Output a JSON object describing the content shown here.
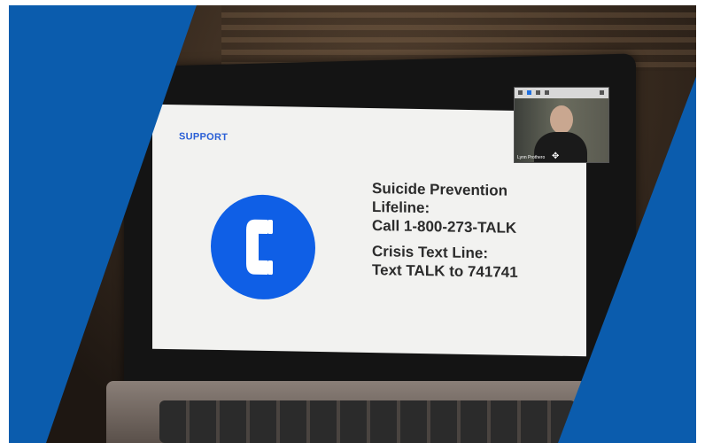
{
  "slide": {
    "label": "SUPPORT",
    "lines_group1": [
      "Suicide Prevention",
      "Lifeline:",
      "Call 1-800-273-TALK"
    ],
    "lines_group2": [
      "Crisis Text Line:",
      "Text TALK to 741741"
    ],
    "icon": "phone-icon"
  },
  "video_tile": {
    "name": "Lynn Prothero"
  },
  "colors": {
    "brand_blue": "#0b5cad",
    "icon_blue": "#0f5fe6",
    "label_blue": "#2a5fd6"
  }
}
